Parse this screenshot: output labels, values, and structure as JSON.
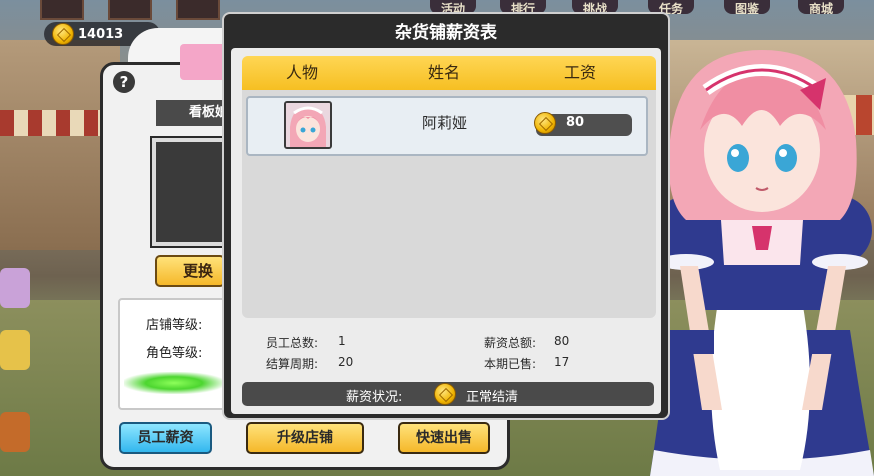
{
  "hud": {
    "gold_amount": "14013",
    "top_tabs": [
      "活动",
      "排行",
      "挑战",
      "任务",
      "图鉴",
      "商城"
    ]
  },
  "shop_panel": {
    "help_symbol": "?",
    "tag_label": "看板娘",
    "change_button": "更换",
    "shop_level_label": "店铺等级:",
    "char_level_label": "角色等级:",
    "buttons": {
      "staff_salary": "员工薪资",
      "upgrade_shop": "升级店铺",
      "quick_sell": "快速出售"
    }
  },
  "payroll_dialog": {
    "title": "杂货铺薪资表",
    "columns": [
      "人物",
      "姓名",
      "工资"
    ],
    "rows": [
      {
        "name": "阿莉娅",
        "salary": "80"
      }
    ],
    "stats": {
      "staff_count_label": "员工总数:",
      "staff_count": "1",
      "salary_total_label": "薪资总额:",
      "salary_total": "80",
      "cycle_label": "结算周期:",
      "cycle": "20",
      "sold_label": "本期已售:",
      "sold": "17"
    },
    "status_label": "薪资状况:",
    "status_value": "正常结清"
  },
  "colors": {
    "header_gold": "#f6bf22",
    "dialog_frame": "#2b2b2b",
    "button_blue": "#33b7ee",
    "button_gold": "#f5b82a"
  }
}
